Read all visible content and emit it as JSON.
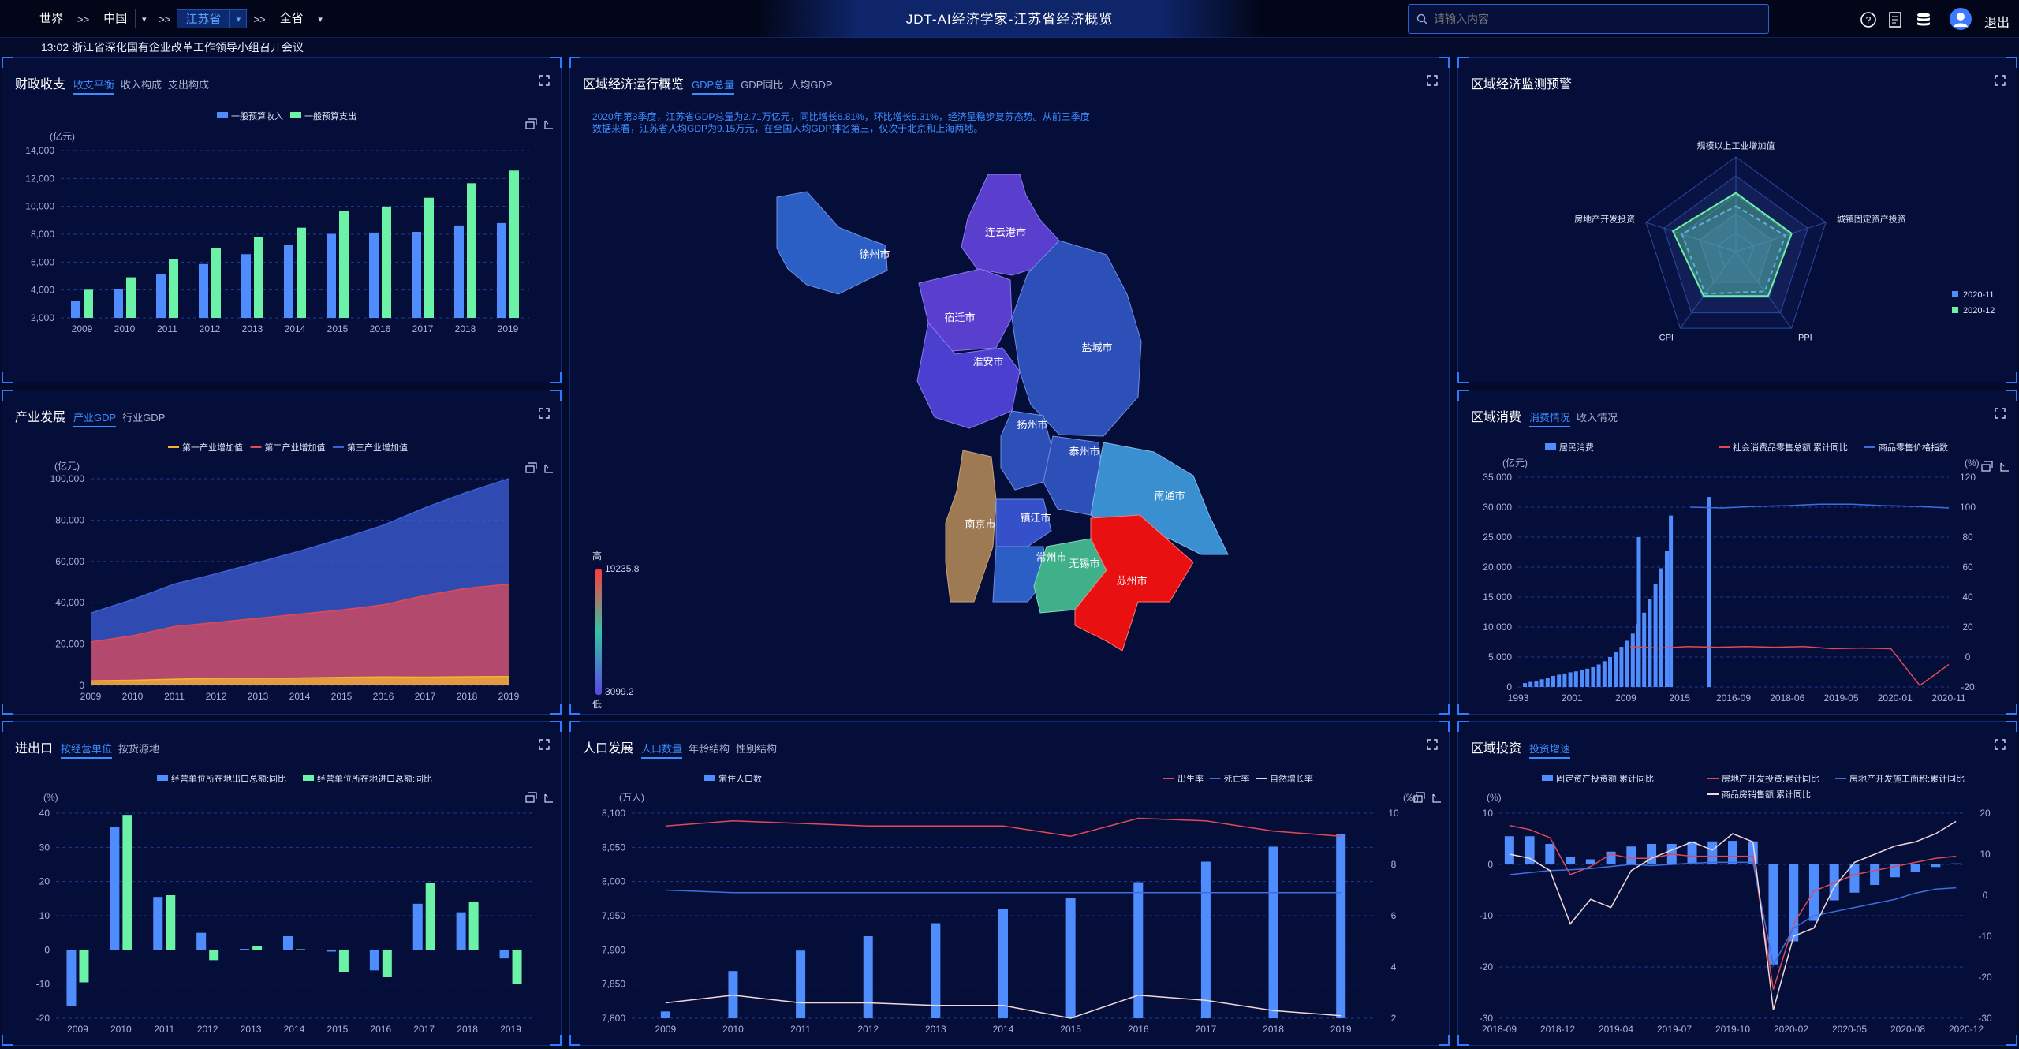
{
  "header": {
    "title": "JDT-AI经济学家-江苏省经济概览",
    "nav": {
      "world": "世界",
      "sep": ">>",
      "china": "中国",
      "province": "江苏省",
      "all": "全省"
    },
    "search_placeholder": "请输入内容",
    "logout": "退出",
    "icons": [
      "help-icon",
      "report-icon",
      "database-icon",
      "user-avatar-icon"
    ]
  },
  "ticker": "13:02  浙江省深化国有企业改革工作领导小组召开会议",
  "fiscal": {
    "title": "财政收支",
    "tabs": [
      "收支平衡",
      "收入构成",
      "支出构成"
    ],
    "legend": [
      "一般预算收入",
      "一般预算支出"
    ],
    "unit": "(亿元)"
  },
  "industry": {
    "title": "产业发展",
    "tabs": [
      "产业GDP",
      "行业GDP"
    ],
    "legend": [
      "第一产业增加值",
      "第二产业增加值",
      "第三产业增加值"
    ],
    "unit": "(亿元)"
  },
  "trade": {
    "title": "进出口",
    "tabs": [
      "按经营单位",
      "按货源地"
    ],
    "legend": [
      "经营单位所在地出口总额:同比",
      "经营单位所在地进口总额:同比"
    ],
    "unit": "(%)"
  },
  "region": {
    "title": "区域经济运行概览",
    "tabs": [
      "GDP总量",
      "GDP同比",
      "人均GDP"
    ],
    "desc": "2020年第3季度，江苏省GDP总量为2.71万亿元，同比增长6.81%，环比增长5.31%，经济呈稳步复苏态势。从前三季度数据来看，江苏省人均GDP为9.15万元，在全国人均GDP排名第三，仅次于北京和上海两地。",
    "scale_high_label": "高",
    "scale_low_label": "低",
    "scale_max": "19235.8",
    "scale_min": "3099.2",
    "cities": [
      "徐州市",
      "连云港市",
      "宿迁市",
      "淮安市",
      "盐城市",
      "扬州市",
      "泰州市",
      "南通市",
      "南京市",
      "镇江市",
      "常州市",
      "无锡市",
      "苏州市"
    ]
  },
  "population": {
    "title": "人口发展",
    "tabs": [
      "人口数量",
      "年龄结构",
      "性别结构"
    ],
    "legend_bar": "常住人口数",
    "legend_lines": [
      "出生率",
      "死亡率",
      "自然增长率"
    ],
    "unit_left": "(万人)",
    "unit_right": "(‰)"
  },
  "monitor": {
    "title": "区域经济监测预警",
    "indicators": [
      "规模以上工业增加值",
      "城镇固定资产投资",
      "PPI",
      "CPI",
      "房地产开发投资"
    ],
    "legend": [
      "2020-11",
      "2020-12"
    ]
  },
  "consumption": {
    "title": "区域消费",
    "tabs": [
      "消费情况",
      "收入情况"
    ],
    "legend_bar": "居民消费",
    "legend_lines": [
      "社会消费品零售总额:累计同比",
      "商品零售价格指数"
    ],
    "unit_left": "(亿元)",
    "unit_right": "(%)"
  },
  "investment": {
    "title": "区域投资",
    "tabs": [
      "投资增速"
    ],
    "legend": [
      "固定资产投资额:累计同比",
      "房地产开发投资:累计同比",
      "房地产开发施工面积:累计同比",
      "商品房销售额:累计同比"
    ],
    "unit_left": "(%)"
  },
  "chart_data": [
    {
      "id": "fiscal",
      "type": "bar",
      "categories": [
        "2009",
        "2010",
        "2011",
        "2012",
        "2013",
        "2014",
        "2015",
        "2016",
        "2017",
        "2018",
        "2019"
      ],
      "series": [
        {
          "name": "一般预算收入",
          "values": [
            3230,
            4080,
            5150,
            5860,
            6570,
            7230,
            8030,
            8120,
            8170,
            8630,
            8800
          ]
        },
        {
          "name": "一般预算支出",
          "values": [
            4020,
            4910,
            6220,
            7030,
            7800,
            8470,
            9690,
            9990,
            10620,
            11660,
            12570
          ]
        }
      ],
      "ylim": [
        2000,
        14000
      ],
      "yticks": [
        "2,000",
        "4,000",
        "6,000",
        "8,000",
        "10,000",
        "12,000",
        "14,000"
      ],
      "colors": [
        "#4f8dff",
        "#6cf2a6"
      ]
    },
    {
      "id": "industry",
      "type": "area",
      "categories": [
        "2009",
        "2010",
        "2011",
        "2012",
        "2013",
        "2014",
        "2015",
        "2016",
        "2017",
        "2018",
        "2019"
      ],
      "series": [
        {
          "name": "第一产业增加值",
          "values": [
            2200,
            2500,
            3000,
            3400,
            3500,
            3600,
            3900,
            4100,
            4000,
            4200,
            4300
          ]
        },
        {
          "name": "第二产业增加值",
          "values": [
            21000,
            24000,
            28500,
            30500,
            32500,
            34500,
            36500,
            39000,
            43500,
            47000,
            49000
          ]
        },
        {
          "name": "第三产业增加值",
          "values": [
            35000,
            41500,
            49000,
            54000,
            59500,
            65000,
            71000,
            77500,
            86000,
            93500,
            100000
          ]
        }
      ],
      "ylim": [
        0,
        100000
      ],
      "yticks": [
        "0",
        "20,000",
        "40,000",
        "60,000",
        "80,000",
        "100,000"
      ],
      "colors": [
        "#f3b532",
        "#e04a55",
        "#3d5fd8"
      ]
    },
    {
      "id": "trade",
      "type": "bar",
      "categories": [
        "2009",
        "2010",
        "2011",
        "2012",
        "2013",
        "2014",
        "2015",
        "2016",
        "2017",
        "2018",
        "2019"
      ],
      "series": [
        {
          "name": "经营单位所在地出口总额:同比",
          "values": [
            -16.5,
            36,
            15.5,
            5,
            0.3,
            4,
            -0.5,
            -6,
            13.5,
            11,
            -2.5
          ]
        },
        {
          "name": "经营单位所在地进口总额:同比",
          "values": [
            -9.5,
            39.5,
            16,
            -3,
            1,
            0.2,
            -6.5,
            -8,
            19.5,
            14,
            -10
          ]
        }
      ],
      "ylim": [
        -20,
        40
      ],
      "yticks": [
        "-20",
        "-10",
        "0",
        "10",
        "20",
        "30",
        "40"
      ],
      "colors": [
        "#4f8dff",
        "#6cf2a6"
      ]
    },
    {
      "id": "population",
      "type": "bar+line",
      "categories": [
        "2009",
        "2010",
        "2011",
        "2012",
        "2013",
        "2014",
        "2015",
        "2016",
        "2017",
        "2018",
        "2019"
      ],
      "series": [
        {
          "name": "常住人口数",
          "values": [
            7810,
            7869,
            7899,
            7920,
            7939,
            7960,
            7976,
            7999,
            8029,
            8051,
            8070
          ]
        },
        {
          "name": "出生率",
          "values": [
            9.5,
            9.7,
            9.6,
            9.5,
            9.5,
            9.5,
            9.1,
            9.8,
            9.7,
            9.3,
            9.1
          ]
        },
        {
          "name": "死亡率",
          "values": [
            7.0,
            6.9,
            6.9,
            6.9,
            6.9,
            6.9,
            6.9,
            6.9,
            6.9,
            6.9,
            6.9
          ]
        },
        {
          "name": "自然增长率",
          "values": [
            2.6,
            2.9,
            2.6,
            2.6,
            2.5,
            2.5,
            2.0,
            2.9,
            2.7,
            2.3,
            2.1
          ]
        }
      ],
      "ylim_left": [
        7800,
        8100
      ],
      "yticks_left": [
        "7,800",
        "7,850",
        "7,900",
        "7,950",
        "8,000",
        "8,050",
        "8,100"
      ],
      "ylim_right": [
        2,
        10
      ],
      "yticks_right": [
        "2",
        "4",
        "6",
        "8",
        "10"
      ],
      "colors": [
        "#4f8dff",
        "#e04a55",
        "#3d6ee0",
        "#f2d7d7"
      ]
    },
    {
      "id": "monitor",
      "type": "radar",
      "indicators": [
        "规模以上工业增加值",
        "城镇固定资产投资",
        "PPI",
        "CPI",
        "房地产开发投资"
      ],
      "series": [
        {
          "name": "2020-11",
          "values": [
            0.48,
            0.55,
            0.52,
            0.55,
            0.6
          ]
        },
        {
          "name": "2020-12",
          "values": [
            0.62,
            0.62,
            0.58,
            0.58,
            0.7
          ]
        }
      ],
      "colors": [
        "#4f8dff",
        "#6cf2a6"
      ]
    },
    {
      "id": "consumption",
      "type": "bar+line",
      "xticks": [
        "1993",
        "2001",
        "2009",
        "2015",
        "2016-09",
        "2018-06",
        "2019-05",
        "2020-01",
        "2020-11"
      ],
      "ylim_left": [
        0,
        35000
      ],
      "yticks_left": [
        "0",
        "5,000",
        "10,000",
        "15,000",
        "20,000",
        "25,000",
        "30,000",
        "35,000"
      ],
      "ylim_right": [
        -20,
        120
      ],
      "yticks_right": [
        "-20",
        "0",
        "20",
        "40",
        "60",
        "80",
        "100",
        "120"
      ],
      "series": [
        {
          "name": "居民消费",
          "values": [
            650,
            850,
            1050,
            1280,
            1550,
            1850,
            2050,
            2250,
            2450,
            2600,
            2800,
            3050,
            3300,
            3750,
            4300,
            5000,
            5800,
            6700,
            7700,
            8900,
            10500,
            12400,
            14700,
            17200,
            19800,
            22700,
            25000,
            28600,
            31700
          ]
        },
        {
          "name": "社会消费品零售总额:累计同比",
          "values": [
            7,
            6,
            7,
            6.5,
            7,
            6.5,
            7,
            5.5,
            6,
            5.5,
            -19,
            -5
          ]
        },
        {
          "name": "商品零售价格指数",
          "values": [
            100,
            99.5,
            100.5,
            101,
            102,
            102,
            101,
            100.5,
            99.5
          ]
        }
      ],
      "colors": [
        "#4f8dff",
        "#e04a55",
        "#3d6ee0"
      ]
    },
    {
      "id": "investment",
      "type": "bar+line",
      "xticks": [
        "2018-09",
        "2018-12",
        "2019-04",
        "2019-07",
        "2019-10",
        "2020-02",
        "2020-05",
        "2020-08",
        "2020-12"
      ],
      "ylim_left": [
        -30,
        10
      ],
      "yticks_left": [
        "-30",
        "-20",
        "-10",
        "0",
        "10"
      ],
      "ylim_right": [
        -30,
        20
      ],
      "yticks_right": [
        "-30",
        "-20",
        "-10",
        "0",
        "10",
        "20"
      ],
      "series": [
        {
          "name": "固定资产投资额:累计同比",
          "values": [
            5.5,
            5.5,
            4,
            1.5,
            1,
            2.5,
            3.5,
            4,
            4,
            4.5,
            4.5,
            4.6,
            4.5,
            -19.5,
            -15,
            -11,
            -7,
            -5.5,
            -4,
            -2.5,
            -1.5,
            -0.5,
            0.2
          ]
        },
        {
          "name": "房地产开发投资:累计同比",
          "values": [
            17,
            16,
            14,
            5,
            7,
            10,
            9,
            9,
            10,
            9.5,
            9.5,
            9.5,
            9.5,
            -23,
            -7,
            1,
            3,
            5,
            6,
            7,
            8,
            9,
            9.5
          ]
        },
        {
          "name": "房地产开发施工面积:累计同比",
          "values": [
            5,
            5.5,
            6,
            6.2,
            6.5,
            7,
            7.5,
            7.2,
            7.5,
            7.8,
            8,
            8,
            8,
            -17,
            -8,
            -5,
            -4,
            -3,
            -2,
            -1,
            0.5,
            1.5,
            1.8
          ]
        },
        {
          "name": "商品房销售额:累计同比",
          "values": [
            10,
            9,
            6,
            -7,
            -1,
            -3,
            6,
            9,
            11,
            13,
            11,
            15,
            13,
            -28,
            -10,
            -8,
            2,
            8,
            10,
            12,
            13,
            15,
            18
          ]
        }
      ],
      "colors": [
        "#4f8dff",
        "#e04a55",
        "#3d6ee0",
        "#f2d7d7"
      ]
    }
  ]
}
